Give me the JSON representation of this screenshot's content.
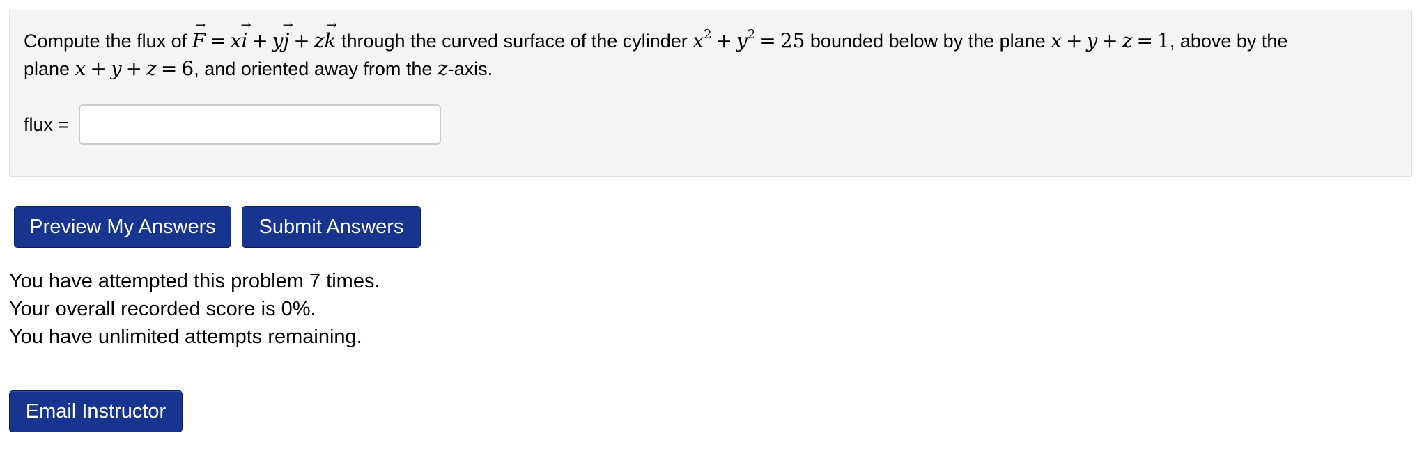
{
  "problem": {
    "t1": "Compute the flux of ",
    "F": "F",
    "eq": "=",
    "x1": "x",
    "i": "i",
    "plus": "+",
    "y1": "y",
    "j": "j",
    "z1": "z",
    "k": "k",
    "t2": " through the curved surface of the cylinder ",
    "cx": "x",
    "two": "2",
    "cy": "y",
    "twentyfive": "25",
    "t3": " bounded below by the plane ",
    "px": "x",
    "py": "y",
    "pz": "z",
    "one": "1",
    "t4": ", above by the",
    "t5": "plane ",
    "six": "6",
    "t6": ", and oriented away from the ",
    "zaxis": "z",
    "t7": "-axis."
  },
  "answer": {
    "label": "flux =",
    "value": ""
  },
  "buttons": {
    "preview": "Preview My Answers",
    "submit": "Submit Answers",
    "email": "Email Instructor"
  },
  "status": {
    "attempts": "You have attempted this problem 7 times.",
    "score": "Your overall recorded score is 0%.",
    "remaining": "You have unlimited attempts remaining."
  },
  "colors": {
    "button_bg": "#17348e",
    "panel_bg": "#f4f4f4"
  }
}
